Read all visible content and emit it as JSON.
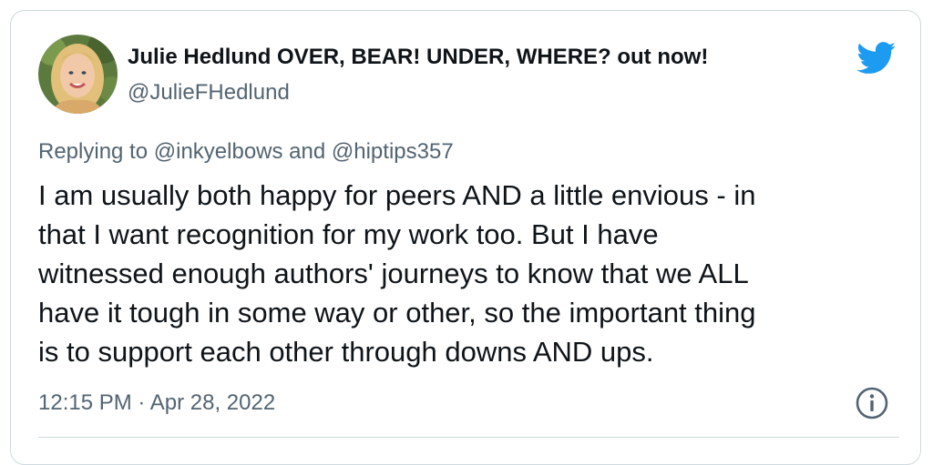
{
  "author": {
    "name": "Julie Hedlund OVER, BEAR! UNDER, WHERE? out now!",
    "handle": "@JulieFHedlund"
  },
  "reply": {
    "prefix": "Replying to ",
    "mention_1": "@inkyelbows",
    "connector": " and ",
    "mention_2": "@hiptips357"
  },
  "tweet": {
    "lines": [
      "I am usually both happy for peers AND a little envious - in",
      "that I want recognition for my work too. But I have",
      "witnessed enough authors' journeys to know that we ALL",
      "have it tough in some way or other, so the important thing",
      "is to support each other through downs AND ups."
    ]
  },
  "meta": {
    "timestamp": "12:15 PM · Apr 28, 2022"
  },
  "icons": {
    "logo": "twitter-bird-icon",
    "info": "info-icon",
    "avatar": "profile-photo"
  },
  "colors": {
    "brand": "#1d9bf0",
    "text_primary": "#0f1419",
    "text_secondary": "#536471",
    "border": "#cfd9de"
  }
}
